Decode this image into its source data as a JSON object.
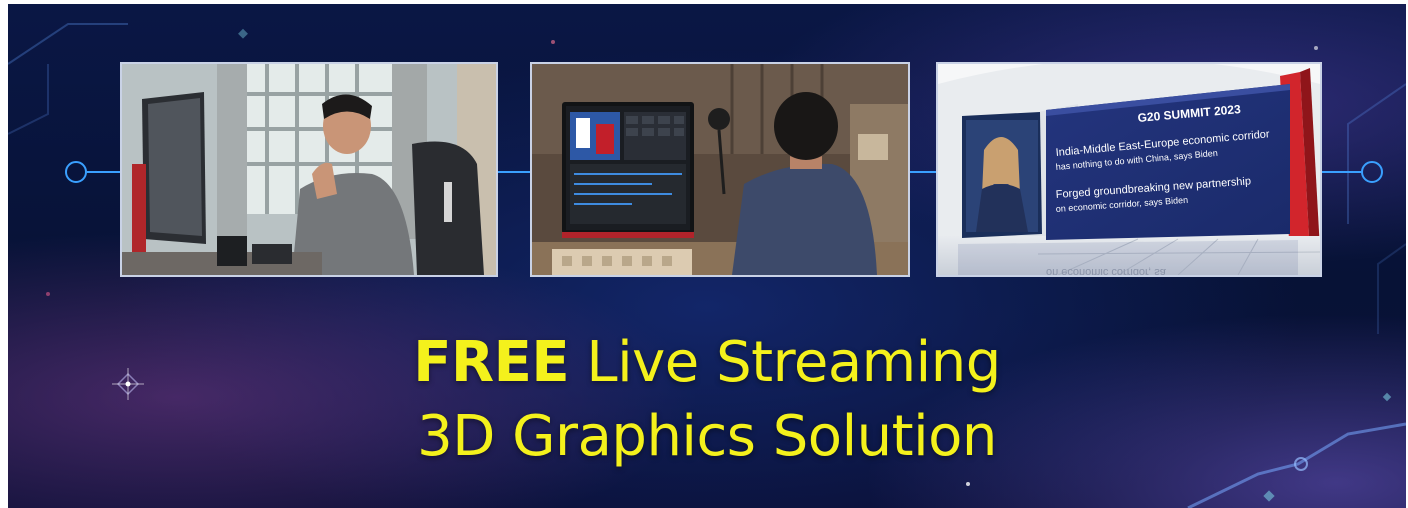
{
  "headline": {
    "line1_bold": "FREE",
    "line1_rest": " Live Streaming",
    "line2": "3D Graphics Solution"
  },
  "news_panel": {
    "title": "G20 SUMMIT 2023",
    "headline1_line1": "India-Middle East-Europe economic corridor",
    "headline1_line2": "has nothing to do with China, says Biden",
    "headline2_line1": "Forged groundbreaking new partnership",
    "headline2_line2": "on economic corridor, says Biden",
    "reflection": "on economic corridor, sa"
  },
  "colors": {
    "headline": "#f4f11c",
    "accent_line": "#3aa0ff",
    "background": "#0a1745"
  }
}
